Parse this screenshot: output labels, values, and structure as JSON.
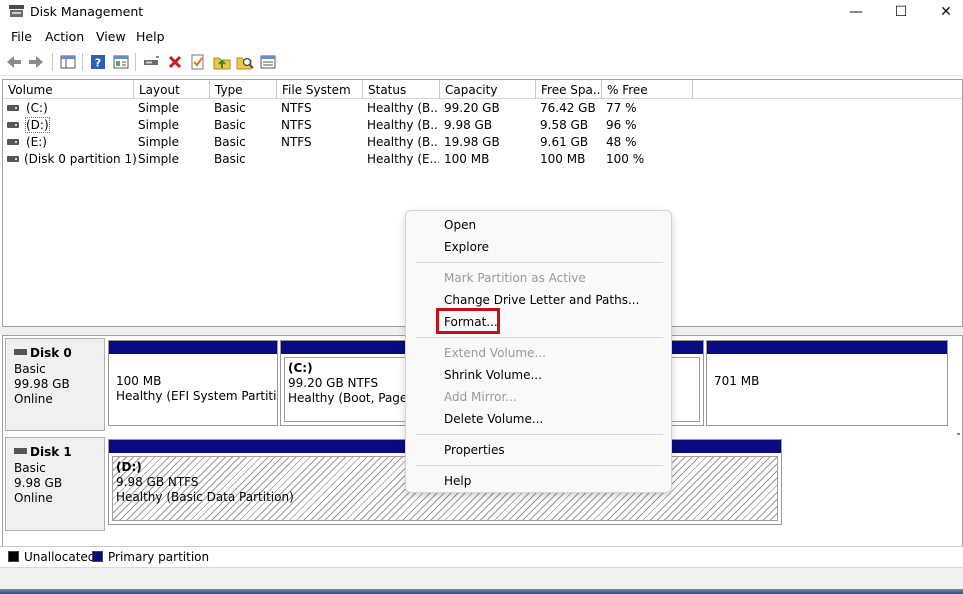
{
  "window": {
    "title": "Disk Management",
    "minimize_glyph": "—",
    "maximize_glyph": "☐",
    "close_glyph": "✕"
  },
  "menu": [
    "File",
    "Action",
    "View",
    "Help"
  ],
  "toolbar_icons": [
    "back-arrow-icon",
    "forward-arrow-icon",
    "show-hide-console-tree-icon",
    "help-icon",
    "properties-view-icon",
    "connect-drive-icon",
    "delete-icon",
    "check-icon",
    "up-folder-icon",
    "search-folder-icon",
    "list-view-icon"
  ],
  "volume_list": {
    "columns": [
      "Volume",
      "Layout",
      "Type",
      "File System",
      "Status",
      "Capacity",
      "Free Spa...",
      "% Free"
    ],
    "rows": [
      {
        "volume": "(C:)",
        "layout": "Simple",
        "type": "Basic",
        "fs": "NTFS",
        "status": "Healthy (B...",
        "capacity": "99.20 GB",
        "free": "76.42 GB",
        "pct": "77 %"
      },
      {
        "volume": "(D:)",
        "layout": "Simple",
        "type": "Basic",
        "fs": "NTFS",
        "status": "Healthy (B...",
        "capacity": "9.98 GB",
        "free": "9.58 GB",
        "pct": "96 %"
      },
      {
        "volume": "(E:)",
        "layout": "Simple",
        "type": "Basic",
        "fs": "NTFS",
        "status": "Healthy (B...",
        "capacity": "19.98 GB",
        "free": "9.61 GB",
        "pct": "48 %"
      },
      {
        "volume": "(Disk 0 partition 1)",
        "layout": "Simple",
        "type": "Basic",
        "fs": "",
        "status": "Healthy (E...",
        "capacity": "100 MB",
        "free": "100 MB",
        "pct": "100 %"
      }
    ]
  },
  "disks": [
    {
      "name": "Disk 0",
      "kind": "Basic",
      "size": "99.98 GB",
      "state": "Online",
      "partitions": [
        {
          "name": "",
          "size": "100 MB",
          "status": "Healthy (EFI System Partition)"
        },
        {
          "name": "(C:)",
          "size": "99.20 GB NTFS",
          "status": "Healthy (Boot, Page Fil"
        },
        {
          "name": "",
          "size": "701 MB",
          "status": ""
        }
      ]
    },
    {
      "name": "Disk 1",
      "kind": "Basic",
      "size": "9.98 GB",
      "state": "Online",
      "partitions": [
        {
          "name": "(D:)",
          "size": "9.98 GB NTFS",
          "status": "Healthy (Basic Data Partition)"
        }
      ]
    }
  ],
  "legend": {
    "unallocated": "Unallocated",
    "primary": "Primary partition",
    "unallocated_color": "#000000",
    "primary_color": "#0a0a83"
  },
  "context_menu": {
    "open": "Open",
    "explore": "Explore",
    "mark_active": "Mark Partition as Active",
    "change_letter": "Change Drive Letter and Paths...",
    "format": "Format...",
    "extend": "Extend Volume...",
    "shrink": "Shrink Volume...",
    "add_mirror": "Add Mirror...",
    "delete": "Delete Volume...",
    "properties": "Properties",
    "help": "Help",
    "highlight_color": "#c8101a"
  }
}
